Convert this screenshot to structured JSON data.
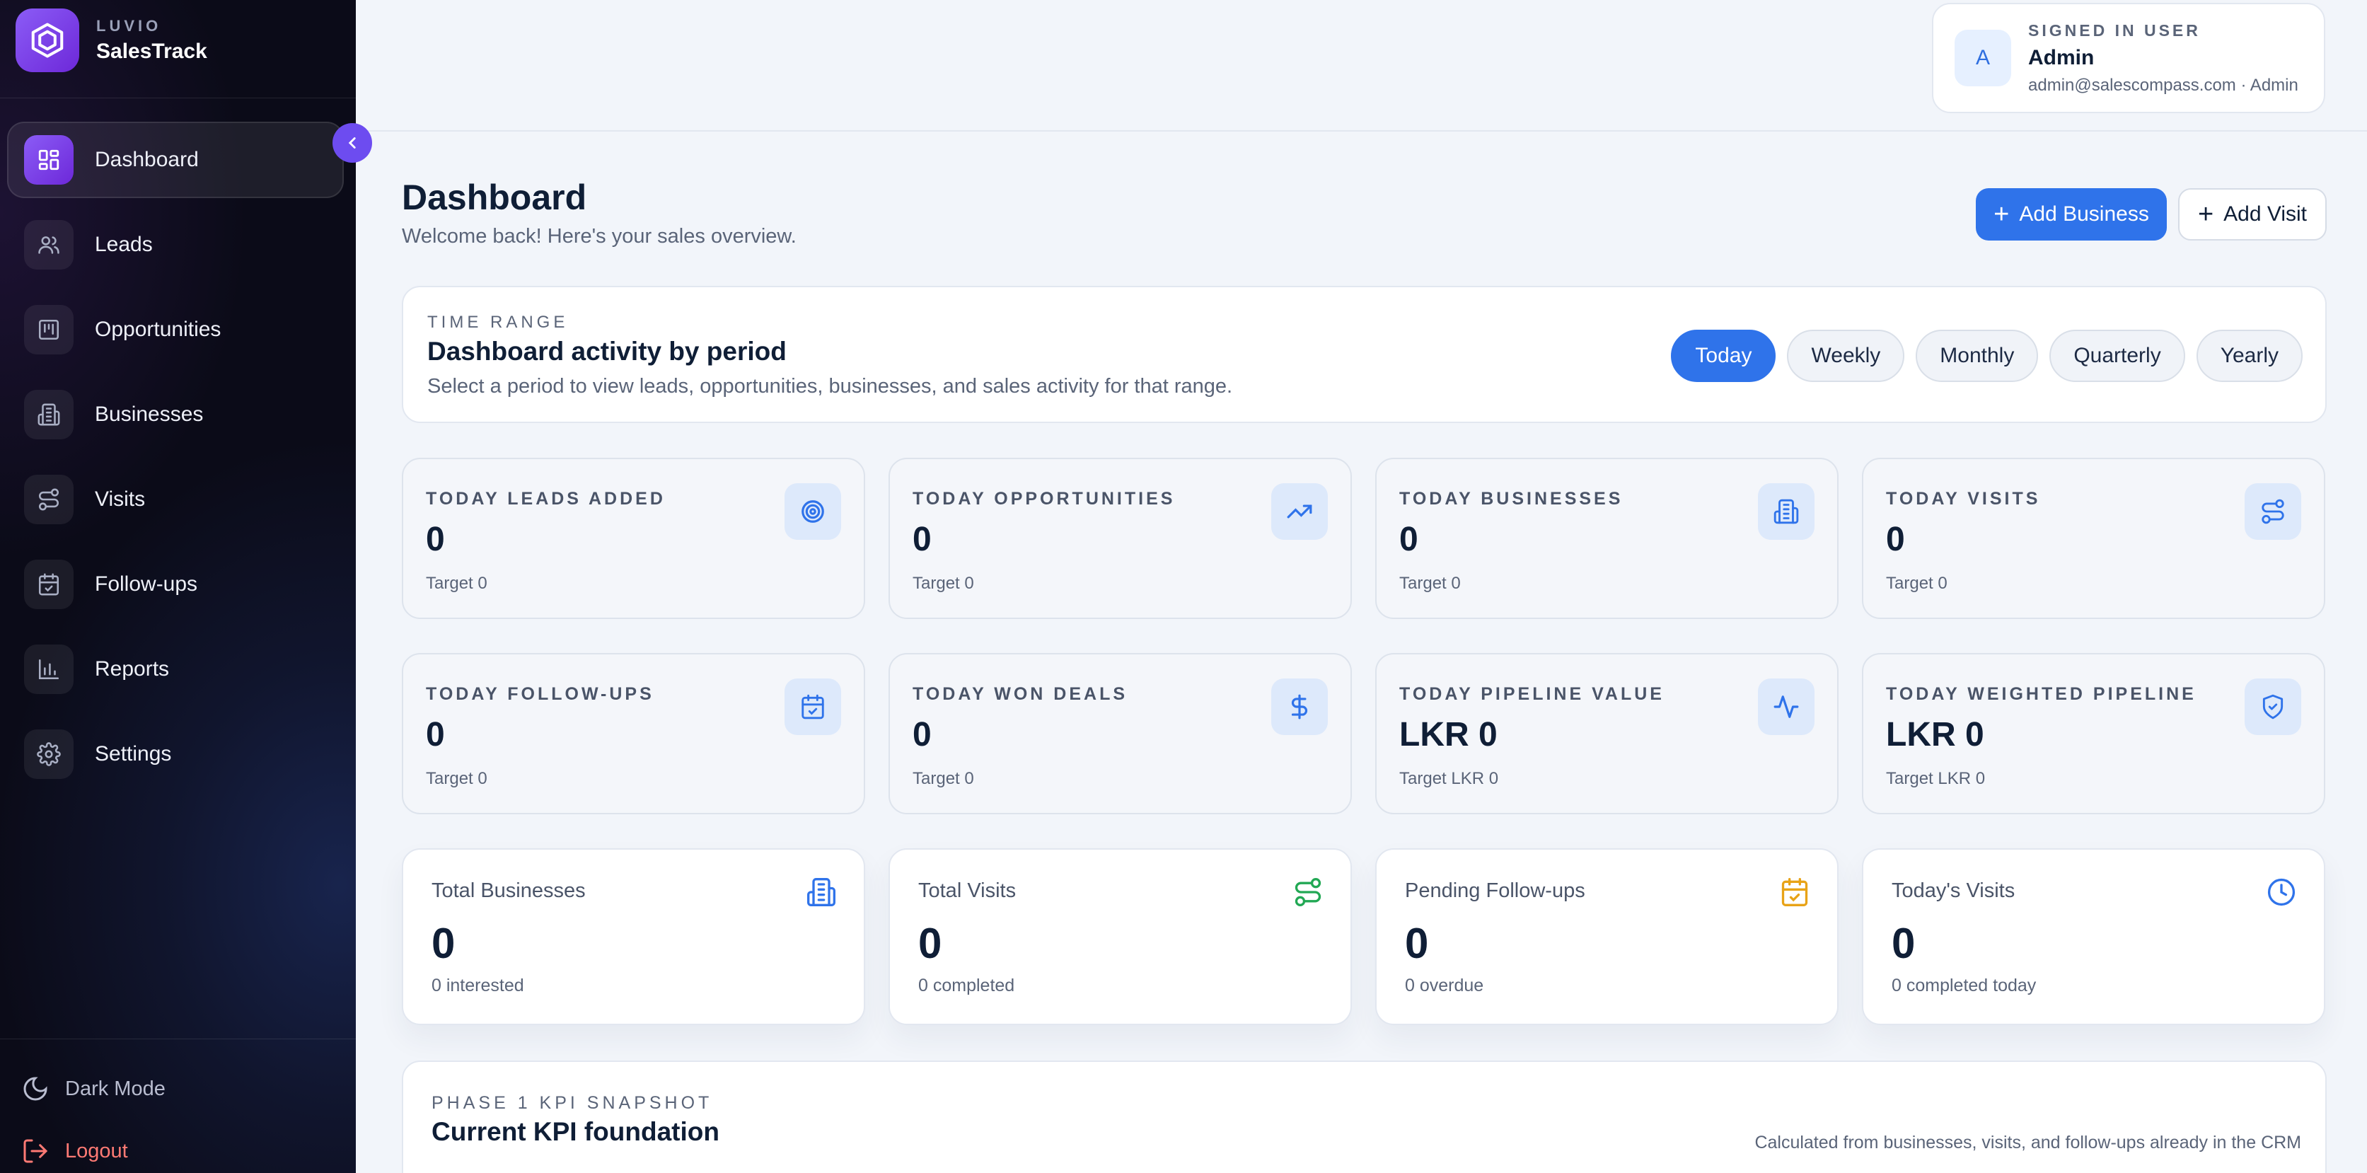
{
  "brand": {
    "small": "LUVIO",
    "name": "SalesTrack"
  },
  "sidebar": {
    "items": [
      {
        "label": "Dashboard",
        "icon": "dashboard-grid-icon",
        "active": true
      },
      {
        "label": "Leads",
        "icon": "users-icon"
      },
      {
        "label": "Opportunities",
        "icon": "kanban-icon"
      },
      {
        "label": "Businesses",
        "icon": "building-icon"
      },
      {
        "label": "Visits",
        "icon": "route-icon"
      },
      {
        "label": "Follow-ups",
        "icon": "calendar-check-icon"
      },
      {
        "label": "Reports",
        "icon": "bar-chart-icon"
      },
      {
        "label": "Settings",
        "icon": "gear-icon"
      }
    ],
    "dark_mode": "Dark Mode",
    "logout": "Logout"
  },
  "user": {
    "label": "SIGNED IN USER",
    "avatar": "A",
    "name": "Admin",
    "email": "admin@salescompass.com · Admin"
  },
  "header": {
    "title": "Dashboard",
    "subtitle": "Welcome back! Here's your sales overview.",
    "add_business": "Add Business",
    "add_visit": "Add Visit"
  },
  "time_range": {
    "label": "TIME RANGE",
    "title": "Dashboard activity by period",
    "description": "Select a period to view leads, opportunities, businesses, and sales activity for that range.",
    "options": [
      "Today",
      "Weekly",
      "Monthly",
      "Quarterly",
      "Yearly"
    ],
    "selected": "Today"
  },
  "stats": [
    {
      "label": "TODAY LEADS ADDED",
      "value": "0",
      "target": "Target 0",
      "icon": "target-icon"
    },
    {
      "label": "TODAY OPPORTUNITIES",
      "value": "0",
      "target": "Target 0",
      "icon": "trending-up-icon"
    },
    {
      "label": "TODAY BUSINESSES",
      "value": "0",
      "target": "Target 0",
      "icon": "building-icon"
    },
    {
      "label": "TODAY VISITS",
      "value": "0",
      "target": "Target 0",
      "icon": "route-icon"
    },
    {
      "label": "TODAY FOLLOW-UPS",
      "value": "0",
      "target": "Target 0",
      "icon": "calendar-check-icon"
    },
    {
      "label": "TODAY WON DEALS",
      "value": "0",
      "target": "Target 0",
      "icon": "dollar-icon"
    },
    {
      "label": "TODAY PIPELINE VALUE",
      "value": "LKR 0",
      "target": "Target LKR 0",
      "icon": "activity-icon"
    },
    {
      "label": "TODAY WEIGHTED PIPELINE",
      "value": "LKR 0",
      "target": "Target LKR 0",
      "icon": "shield-check-icon"
    }
  ],
  "summary": [
    {
      "label": "Total Businesses",
      "value": "0",
      "sub": "0 interested",
      "icon": "building-icon",
      "color": "#2f73ea"
    },
    {
      "label": "Total Visits",
      "value": "0",
      "sub": "0 completed",
      "icon": "route-icon",
      "color": "#22a854"
    },
    {
      "label": "Pending Follow-ups",
      "value": "0",
      "sub": "0 overdue",
      "icon": "calendar-check-icon",
      "color": "#e8a317"
    },
    {
      "label": "Today's Visits",
      "value": "0",
      "sub": "0 completed today",
      "icon": "clock-icon",
      "color": "#2f73ea"
    }
  ],
  "kpi": {
    "label": "PHASE 1 KPI SNAPSHOT",
    "title": "Current KPI foundation",
    "note": "Calculated from businesses, visits, and follow-ups already in the CRM"
  },
  "colors": {
    "accent": "#2f73ea",
    "brand": "#7c3aed",
    "sidebar_bg": "#0b0b18",
    "logout": "#ff7a74"
  }
}
